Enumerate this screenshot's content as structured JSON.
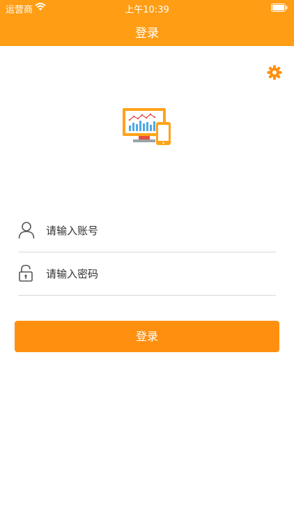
{
  "status_bar": {
    "carrier": "运营商",
    "time": "上午10:39"
  },
  "nav": {
    "title": "登录"
  },
  "form": {
    "username_placeholder": "请输入账号",
    "password_placeholder": "请输入密码",
    "username_value": "",
    "password_value": "",
    "login_label": "登录"
  },
  "icons": {
    "settings": "gear-icon",
    "user": "user-icon",
    "lock": "lock-icon",
    "logo": "monitor-chart-logo"
  },
  "colors": {
    "brand": "#ff9d14",
    "button": "#ff900f",
    "divider": "#d9d9d9"
  }
}
